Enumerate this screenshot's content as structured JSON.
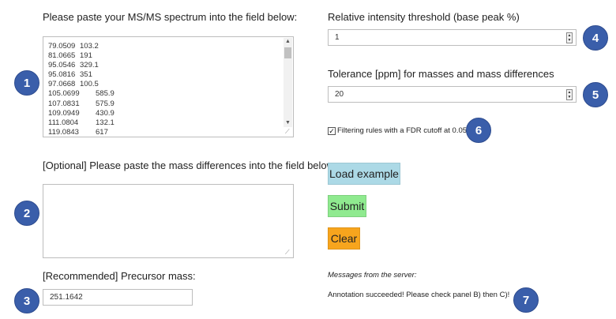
{
  "left": {
    "spectrum_label": "Please paste your MS/MS spectrum into the field below:",
    "spectrum_rows": [
      {
        "mz": "79.0509",
        "intensity": "103.2"
      },
      {
        "mz": "81.0665",
        "intensity": "191"
      },
      {
        "mz": "95.0546",
        "intensity": "329.1"
      },
      {
        "mz": "95.0816",
        "intensity": "351"
      },
      {
        "mz": "97.0668",
        "intensity": "100.5"
      },
      {
        "mz": "105.0699",
        "intensity": "585.9"
      },
      {
        "mz": "107.0831",
        "intensity": "575.9"
      },
      {
        "mz": "109.0949",
        "intensity": "430.9"
      },
      {
        "mz": "111.0804",
        "intensity": "132.1"
      },
      {
        "mz": "119.0843",
        "intensity": "617"
      }
    ],
    "massdiff_label": "[Optional] Please paste the mass differences into the field below:",
    "massdiff_value": "",
    "precursor_label": "[Recommended] Precursor mass:",
    "precursor_value": "251.1642"
  },
  "right": {
    "threshold_label": "Relative intensity threshold (base peak %)",
    "threshold_value": "1",
    "tolerance_label": "Tolerance [ppm] for masses and mass differences",
    "tolerance_value": "20",
    "fdr_label": "Filtering rules with a FDR cutoff at 0.05",
    "fdr_checked": true,
    "load_example_label": "Load example",
    "submit_label": "Submit",
    "clear_label": "Clear",
    "messages_title": "Messages from the server:",
    "messages_text": "Annotation succeeded! Please check panel B) then C)!"
  },
  "badges": [
    "1",
    "2",
    "3",
    "4",
    "5",
    "6",
    "7"
  ],
  "colors": {
    "badge": "#3a5eaa",
    "load_example": "#acd9e6",
    "submit": "#8fea8f",
    "clear": "#f7a51d"
  }
}
